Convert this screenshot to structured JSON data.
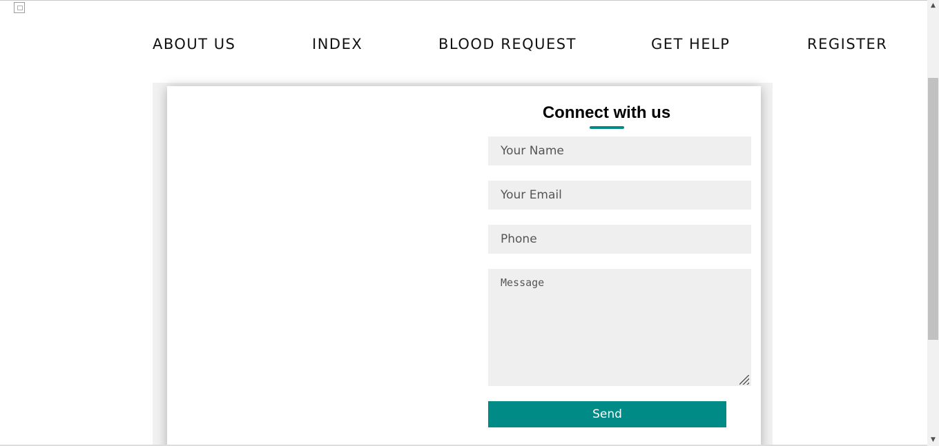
{
  "nav": {
    "items": [
      {
        "label": "ABOUT US"
      },
      {
        "label": "INDEX"
      },
      {
        "label": "BLOOD REQUEST"
      },
      {
        "label": "GET HELP"
      },
      {
        "label": "REGISTER"
      }
    ]
  },
  "contact_form": {
    "title": "Connect with us",
    "name_placeholder": "Your Name",
    "email_placeholder": "Your Email",
    "phone_placeholder": "Phone",
    "message_placeholder": "Message",
    "send_label": "Send"
  },
  "colors": {
    "accent": "#008b87",
    "field_background": "#efefef"
  },
  "icons": {
    "broken_image": "broken-image-icon",
    "scroll_up": "chevron-up-icon",
    "scroll_down": "chevron-down-icon"
  }
}
